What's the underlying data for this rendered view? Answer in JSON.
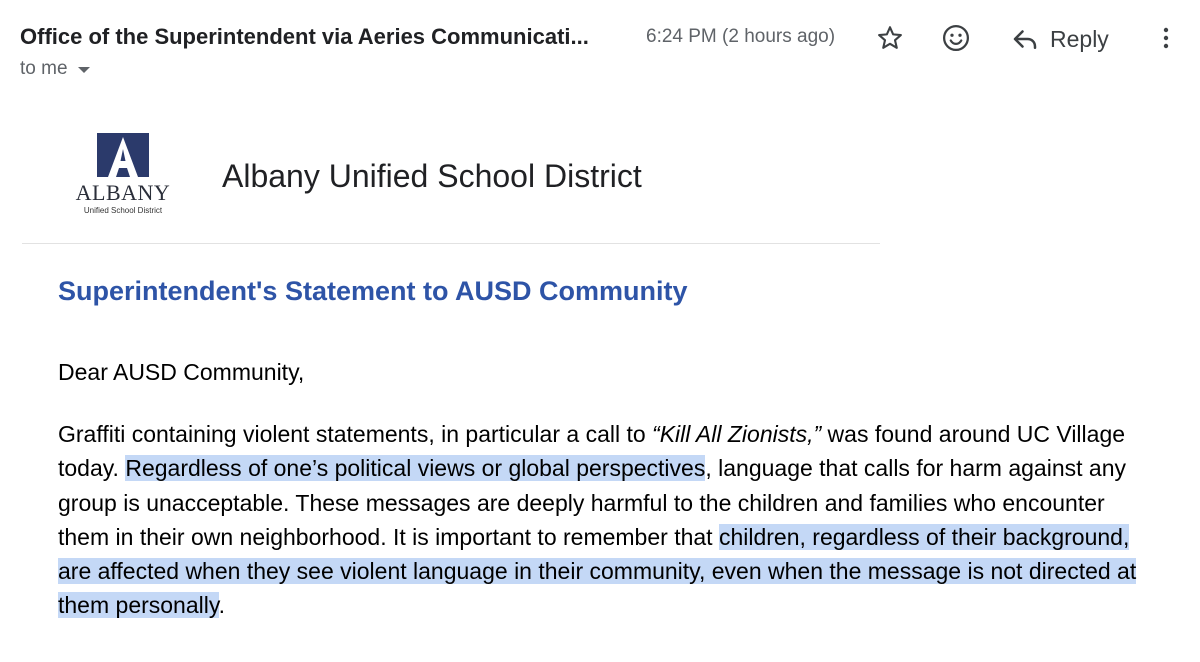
{
  "header": {
    "sender": "Office of the Superintendent via Aeries Communicati...",
    "time": "6:24 PM (2 hours ago)",
    "reply_label": "Reply",
    "recipient": "to me"
  },
  "logo": {
    "word": "ALBANY",
    "subtext": "Unified School District",
    "colors": {
      "navy": "#2b3a6b",
      "dark": "#2b2f3a"
    }
  },
  "district_name": "Albany Unified School District",
  "title": "Superintendent's Statement to AUSD Community",
  "greeting": "Dear AUSD Community,",
  "paragraph": {
    "part1": "Graffiti containing violent statements, in particular a call to ",
    "quote": "“Kill All Zionists,”",
    "part2": "  was found around UC Village today. ",
    "highlight1": "Regardless of one’s political views or global perspectives",
    "part3": ", language that calls for harm against any group is unacceptable. These messages are deeply harmful to the children and families who encounter them in their own neighborhood. It is important to remember that ",
    "highlight2": "children, regardless of their background, are affected when they see violent language in their community, even when the message is not directed at them personally",
    "end": "."
  },
  "icons": [
    "star-icon",
    "smiley-icon",
    "reply-icon",
    "more-vert-icon",
    "caret-down-icon"
  ],
  "colors": {
    "title_blue": "#2e54a7",
    "highlight": "#c4d8f6",
    "muted": "#5f6368"
  }
}
